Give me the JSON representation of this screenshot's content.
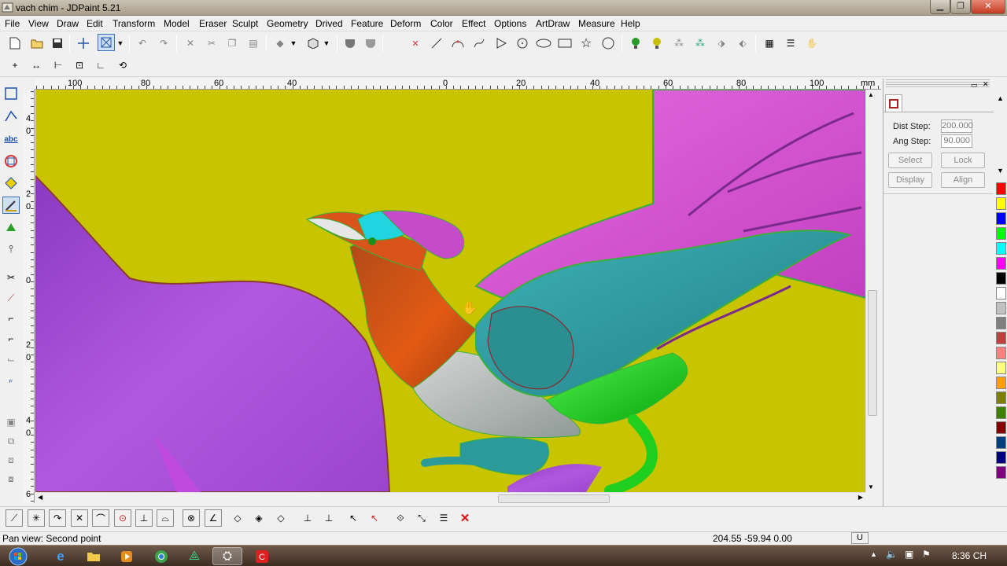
{
  "window": {
    "title": "vach chim - JDPaint 5.21"
  },
  "menu": [
    "File",
    "View",
    "Draw",
    "Edit",
    "Transform",
    "Model",
    "Eraser",
    "Sculpt",
    "Geometry",
    "Drived",
    "Feature",
    "Deform",
    "Color",
    "Effect",
    "Options",
    "ArtDraw",
    "Measure",
    "Help"
  ],
  "ruler": {
    "h_labels": [
      "100",
      "80",
      "60",
      "40",
      "0",
      "20",
      "40",
      "60",
      "80",
      "100"
    ],
    "unit": "mm",
    "v_labels": [
      "4",
      "0",
      "2",
      "0",
      "0",
      "2",
      "0",
      "4",
      "0",
      "6"
    ]
  },
  "panel": {
    "dist_step_label": "Dist Step:",
    "dist_step_value": "200.000",
    "ang_step_label": "Ang Step:",
    "ang_step_value": "90.000",
    "select_label": "Select",
    "lock_label": "Lock",
    "display_label": "Display",
    "align_label": "Align"
  },
  "palette": [
    "#ff0000",
    "#ffff00",
    "#0000ff",
    "#00ff00",
    "#00ffff",
    "#ff00ff",
    "#000000",
    "#ffffff",
    "#c0c0c0",
    "#808080",
    "#c04040",
    "#ff8080",
    "#ffff80",
    "#ffa000",
    "#808000",
    "#408000",
    "#800000",
    "#004080",
    "#000080",
    "#800080"
  ],
  "status": {
    "message": "Pan view: Second point",
    "coords": "204.55  -59.94  0.00",
    "mode": "U"
  },
  "taskbar": {
    "clock": "8:36 CH"
  },
  "colors": {
    "canvas_bg": "#c9c400",
    "wing_purple": "#a94ad6",
    "tail_pink": "#d94fd0",
    "body_orange": "#d9541a",
    "teal": "#2a9a9a",
    "green": "#22cc22"
  }
}
